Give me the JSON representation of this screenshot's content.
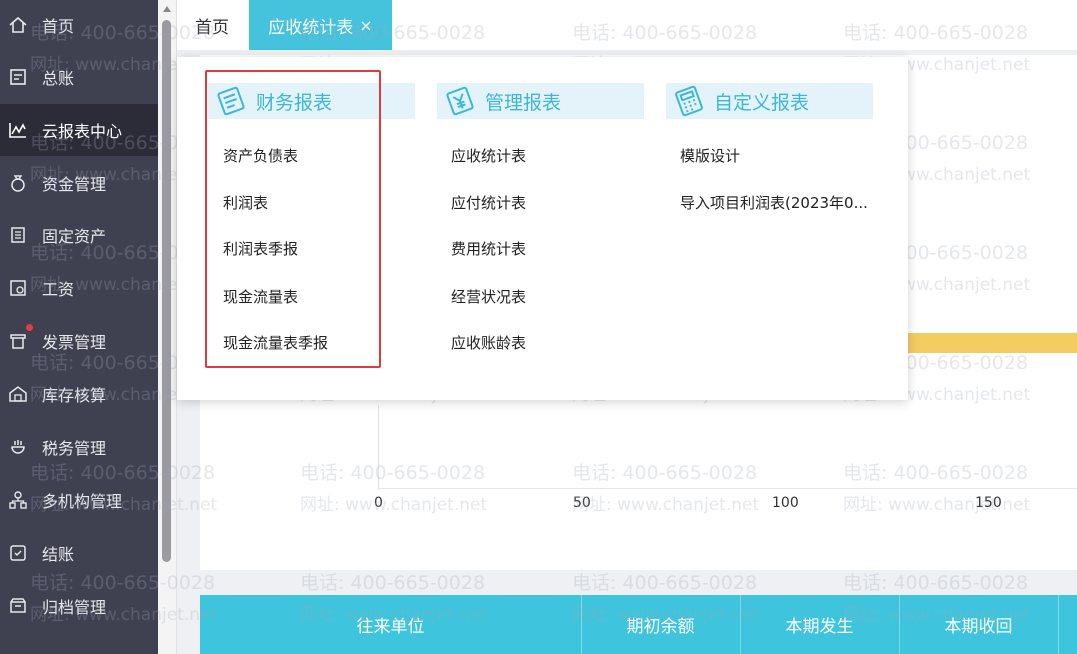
{
  "sidebar": {
    "items": [
      {
        "label": "首页",
        "icon": "home-icon"
      },
      {
        "label": "总账",
        "icon": "ledger-icon"
      },
      {
        "label": "云报表中心",
        "icon": "chart-icon",
        "active": true
      },
      {
        "label": "资金管理",
        "icon": "money-bag-icon"
      },
      {
        "label": "固定资产",
        "icon": "asset-icon"
      },
      {
        "label": "工资",
        "icon": "salary-icon"
      },
      {
        "label": "发票管理",
        "icon": "invoice-icon",
        "badge": true
      },
      {
        "label": "库存核算",
        "icon": "warehouse-icon"
      },
      {
        "label": "税务管理",
        "icon": "tax-icon"
      },
      {
        "label": "多机构管理",
        "icon": "org-icon"
      },
      {
        "label": "结账",
        "icon": "checkout-icon"
      },
      {
        "label": "归档管理",
        "icon": "archive-icon"
      }
    ]
  },
  "tabs": {
    "home": "首页",
    "active": "应收统计表",
    "close": "×"
  },
  "dropdown": {
    "categories": [
      {
        "label": "财务报表",
        "icon": "finance-report-icon",
        "items": [
          "资产负债表",
          "利润表",
          "利润表季报",
          "现金流量表",
          "现金流量表季报"
        ]
      },
      {
        "label": "管理报表",
        "icon": "management-report-icon",
        "items": [
          "应收统计表",
          "应付统计表",
          "费用统计表",
          "经营状况表",
          "应收账龄表"
        ]
      },
      {
        "label": "自定义报表",
        "icon": "custom-report-icon",
        "items": [
          "模版设计",
          "导入项目利润表(2023年0..."
        ]
      }
    ]
  },
  "chart": {
    "ticks": [
      "0",
      "50",
      "100",
      "150"
    ]
  },
  "table": {
    "headers": [
      "往来单位",
      "期初余额",
      "本期发生",
      "本期收回"
    ]
  },
  "watermark": {
    "phone": "电话: 400-665-0028",
    "site": "网址: www.chanjet.net"
  },
  "colors": {
    "accent": "#45c3dd",
    "sidebar": "#3f4151",
    "highlight": "#e23a3a",
    "bar": "#f3cc62"
  }
}
